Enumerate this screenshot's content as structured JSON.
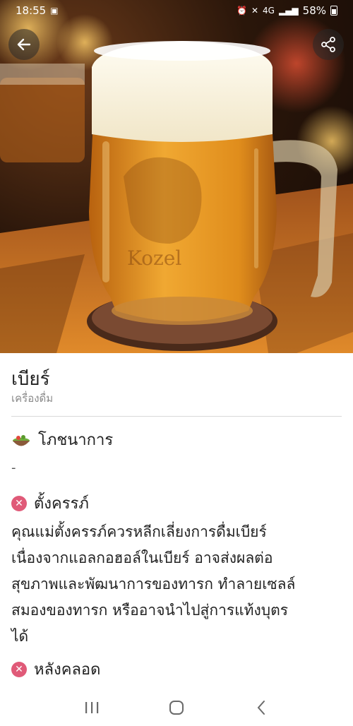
{
  "status_bar": {
    "time": "18:55",
    "network": "4G",
    "battery": "58%"
  },
  "hero": {
    "image_subject": "beer mug with foam",
    "mug_emboss": "Kozel"
  },
  "item": {
    "title": "เบียร์",
    "category": "เครื่องดื่ม"
  },
  "nutrition": {
    "label": "โภชนาการ",
    "value": "-"
  },
  "pregnant": {
    "label": "ตั้งครรภ์",
    "lines": [
      "คุณแม่ตั้งครรภ์ควรหลีกเลี่ยงการดื่มเบียร์",
      "เนื่องจากแอลกอฮอล์ในเบียร์ อาจส่งผลต่อ",
      "สุขภาพและพัฒนาการของทารก ทำลายเซลล์",
      "สมองของทารก หรืออาจนำไปสู่การแท้งบุตร",
      "ได้"
    ]
  },
  "postpartum": {
    "label": "หลังคลอด"
  },
  "icons": {
    "back": "arrow-left-icon",
    "share": "share-icon",
    "nutrition": "salad-bowl-icon",
    "not_allowed": "x-circle-icon",
    "nav_recent": "recent-apps-icon",
    "nav_home": "home-icon",
    "nav_back": "chevron-left-icon"
  },
  "colors": {
    "not_allowed": "#e05a78",
    "divider": "#d9d9d9",
    "subtitle": "#8a8a8a"
  }
}
